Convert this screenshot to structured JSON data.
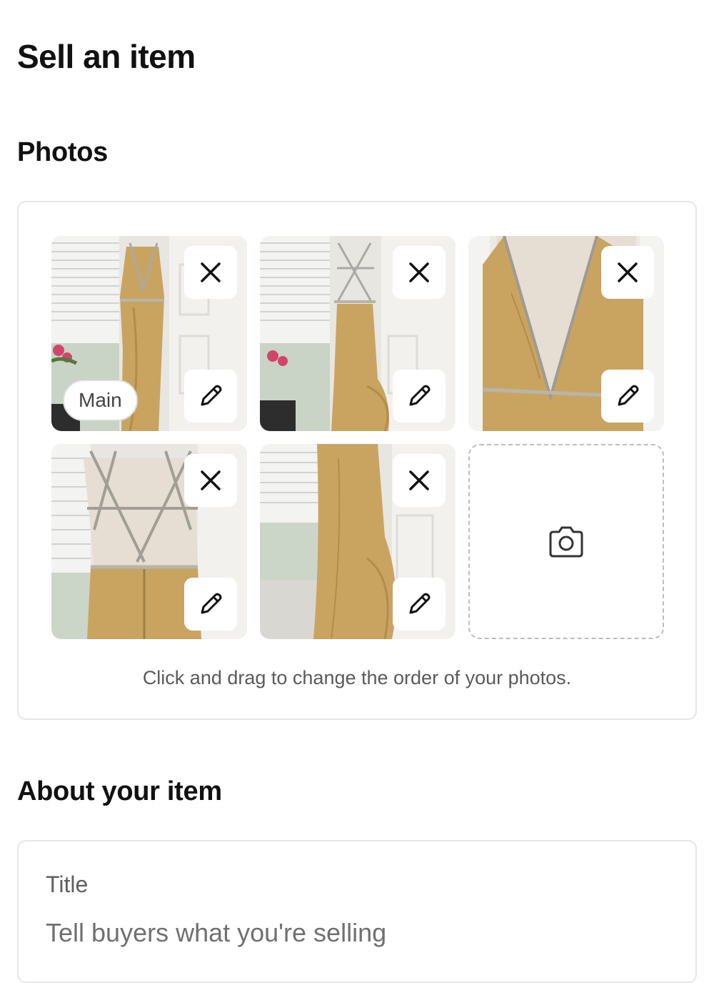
{
  "page": {
    "title": "Sell an item"
  },
  "photos": {
    "heading": "Photos",
    "main_badge": "Main",
    "drag_hint": "Click and drag to change the order of your photos.",
    "items": [
      {
        "description_icon": "dress-front-full"
      },
      {
        "description_icon": "dress-back-full"
      },
      {
        "description_icon": "dress-bodice-closeup"
      },
      {
        "description_icon": "dress-back-straps"
      },
      {
        "description_icon": "dress-skirt-side"
      }
    ]
  },
  "about": {
    "heading": "About your item",
    "title_label": "Title",
    "title_placeholder": "Tell buyers what you're selling",
    "title_value": ""
  },
  "colors": {
    "gold": "#c9a461",
    "border": "#e6e6e6"
  }
}
